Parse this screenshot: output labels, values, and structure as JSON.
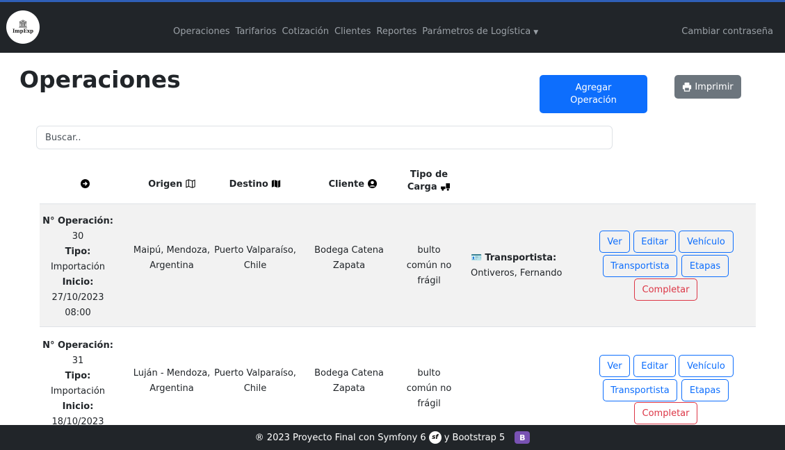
{
  "nav": {
    "logo_text": "ImpExp",
    "links": [
      "Operaciones",
      "Tarifarios",
      "Cotización",
      "Clientes",
      "Reportes",
      "Parámetros de Logística"
    ],
    "right_link": "Cambiar contraseña"
  },
  "page": {
    "title": "Operaciones",
    "add_button": "Agregar Operación",
    "print_button": "Imprimir",
    "search_placeholder": "Buscar.."
  },
  "table": {
    "headers": [
      "Origen",
      "Destino",
      "Cliente",
      "Tipo de Carga"
    ],
    "labels": {
      "op_number": "N° Operación:",
      "type": "Tipo:",
      "start": "Inicio:",
      "carrier": "Transportista:"
    },
    "rows": [
      {
        "op_number": "30",
        "type": "Importación",
        "start_date": "27/10/2023",
        "start_time": "08:00",
        "origin": "Maipú, Mendoza, Argentina",
        "destination": "Puerto Valparaíso, Chile",
        "client": "Bodega Catena Zapata",
        "cargo": "bulto común no frágil",
        "carrier": "Ontiveros, Fernando"
      },
      {
        "op_number": "31",
        "type": "Importación",
        "start_date": "18/10/2023",
        "origin": "Luján - Mendoza, Argentina",
        "destination": "Puerto Valparaíso, Chile",
        "client": "Bodega Catena Zapata",
        "cargo": "bulto común no frágil"
      }
    ],
    "actions": {
      "view": "Ver",
      "edit": "Editar",
      "vehicle": "Vehículo",
      "carrier": "Transportista",
      "stages": "Etapas",
      "complete": "Completar"
    }
  },
  "footer": {
    "text_before": "® 2023 Proyecto Final con Symfony 6",
    "text_after": "y Bootstrap 5",
    "sf_badge": "sf",
    "bs_badge": "B"
  }
}
